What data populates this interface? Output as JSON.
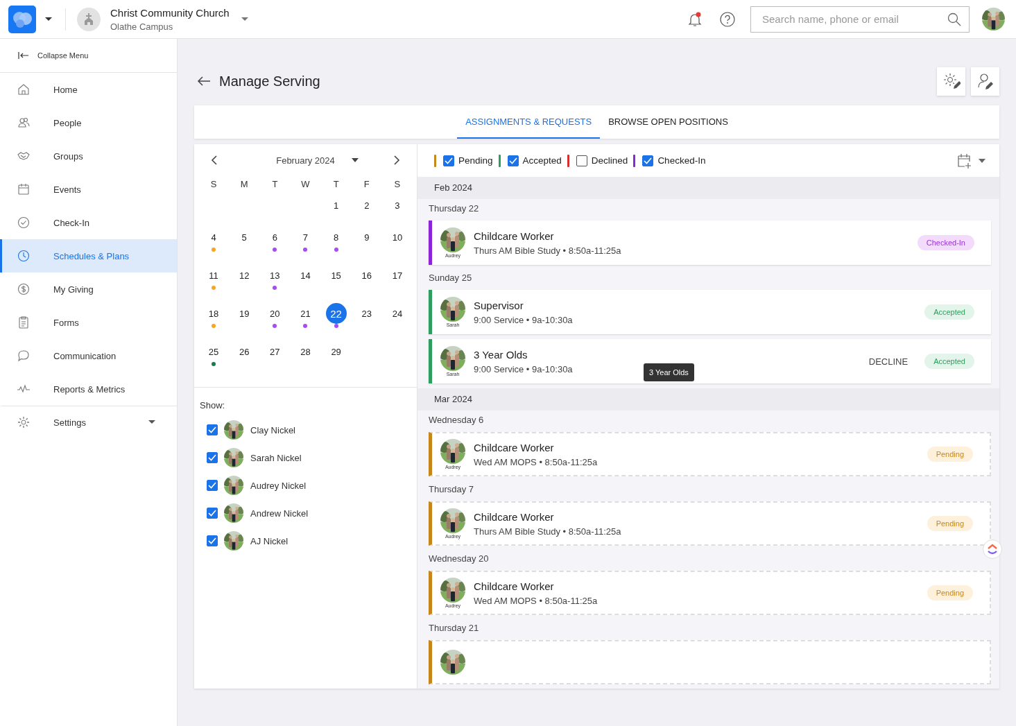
{
  "topbar": {
    "org_name": "Christ Community Church",
    "campus": "Olathe Campus",
    "notification_unread": true,
    "search": {
      "placeholder": "Search name, phone or email"
    }
  },
  "sidebar": {
    "collapse_label": "Collapse Menu",
    "items": [
      {
        "label": "Home",
        "selected": false
      },
      {
        "label": "People",
        "selected": false
      },
      {
        "label": "Groups",
        "selected": false
      },
      {
        "label": "Events",
        "selected": false
      },
      {
        "label": "Check-In",
        "selected": false
      },
      {
        "label": "Schedules & Plans",
        "selected": true
      },
      {
        "label": "My Giving",
        "selected": false
      },
      {
        "label": "Forms",
        "selected": false
      },
      {
        "label": "Communication",
        "selected": false
      },
      {
        "label": "Reports & Metrics",
        "selected": false
      }
    ],
    "settings_label": "Settings"
  },
  "page": {
    "title": "Manage Serving"
  },
  "tabs": [
    {
      "label": "ASSIGNMENTS & REQUESTS",
      "selected": true
    },
    {
      "label": "BROWSE OPEN POSITIONS",
      "selected": false
    }
  ],
  "calendar": {
    "month": "February 2024",
    "weekdays": [
      "S",
      "M",
      "T",
      "W",
      "T",
      "F",
      "S"
    ],
    "weeks": [
      {
        "days": [
          {
            "kind": "blank"
          },
          {
            "kind": "blank"
          },
          {
            "kind": "blank"
          },
          {
            "kind": "blank"
          },
          {
            "kind": "day",
            "day": "1",
            "selected": false
          },
          {
            "kind": "day",
            "day": "2",
            "selected": false
          },
          {
            "kind": "day",
            "day": "3",
            "selected": false
          }
        ]
      },
      {
        "days": [
          {
            "kind": "day",
            "day": "4",
            "selected": false,
            "color": "#f5a623"
          },
          {
            "kind": "day",
            "day": "5",
            "selected": false
          },
          {
            "kind": "day",
            "day": "6",
            "selected": false,
            "color": "#a64cf0"
          },
          {
            "kind": "day",
            "day": "7",
            "selected": false,
            "color": "#a64cf0"
          },
          {
            "kind": "day",
            "day": "8",
            "selected": false,
            "color": "#a64cf0"
          },
          {
            "kind": "day",
            "day": "9",
            "selected": false
          },
          {
            "kind": "day",
            "day": "10",
            "selected": false
          }
        ]
      },
      {
        "days": [
          {
            "kind": "day",
            "day": "11",
            "selected": false,
            "color": "#f5a623"
          },
          {
            "kind": "day",
            "day": "12",
            "selected": false
          },
          {
            "kind": "day",
            "day": "13",
            "selected": false,
            "color": "#a64cf0"
          },
          {
            "kind": "day",
            "day": "14",
            "selected": false
          },
          {
            "kind": "day",
            "day": "15",
            "selected": false
          },
          {
            "kind": "day",
            "day": "16",
            "selected": false
          },
          {
            "kind": "day",
            "day": "17",
            "selected": false
          }
        ]
      },
      {
        "days": [
          {
            "kind": "day",
            "day": "18",
            "selected": false,
            "color": "#f5a623"
          },
          {
            "kind": "day",
            "day": "19",
            "selected": false
          },
          {
            "kind": "day",
            "day": "20",
            "selected": false,
            "color": "#a64cf0"
          },
          {
            "kind": "day",
            "day": "21",
            "selected": false,
            "color": "#a64cf0"
          },
          {
            "kind": "day",
            "day": "22",
            "selected": true,
            "color": "#a64cf0"
          },
          {
            "kind": "day",
            "day": "23",
            "selected": false
          },
          {
            "kind": "day",
            "day": "24",
            "selected": false
          }
        ]
      },
      {
        "days": [
          {
            "kind": "day",
            "day": "25",
            "selected": false,
            "color": "#1e7a4a"
          },
          {
            "kind": "day",
            "day": "26",
            "selected": false
          },
          {
            "kind": "day",
            "day": "27",
            "selected": false
          },
          {
            "kind": "day",
            "day": "28",
            "selected": false
          },
          {
            "kind": "day",
            "day": "29",
            "selected": false
          }
        ]
      }
    ]
  },
  "show": {
    "label": "Show:",
    "people": [
      {
        "name": "Clay Nickel",
        "checked": true
      },
      {
        "name": "Sarah Nickel",
        "checked": true
      },
      {
        "name": "Audrey Nickel",
        "checked": true
      },
      {
        "name": "Andrew Nickel",
        "checked": true
      },
      {
        "name": "AJ Nickel",
        "checked": true
      }
    ]
  },
  "legend": [
    {
      "label": "Pending",
      "color": "#c8861a",
      "checked": true
    },
    {
      "label": "Accepted",
      "color": "#2e9e5e",
      "checked": true
    },
    {
      "label": "Declined",
      "color": "#d32f2f",
      "checked": false
    },
    {
      "label": "Checked-In",
      "color": "#8e24d8",
      "checked": true
    }
  ],
  "months": [
    {
      "label": "Feb 2024",
      "days": [
        {
          "label": "Thursday 22",
          "cards": [
            {
              "kind": "checkedin",
              "title": "Childcare Worker",
              "subtitle": "Thurs AM Bible Study • 8:50a-11:25a",
              "person": "Audrey",
              "badge": "Checked-In"
            }
          ]
        },
        {
          "label": "Sunday 25",
          "cards": [
            {
              "kind": "accepted",
              "title": "Supervisor",
              "subtitle": "9:00 Service • 9a-10:30a",
              "person": "Sarah",
              "badge": "Accepted"
            },
            {
              "kind": "accepted",
              "title": "3 Year Olds",
              "subtitle": "9:00 Service • 9a-10:30a",
              "person": "Sarah",
              "badge": "Accepted",
              "action": "DECLINE",
              "tooltip": "3 Year Olds"
            }
          ]
        }
      ]
    },
    {
      "label": "Mar 2024",
      "days": [
        {
          "label": "Wednesday 6",
          "cards": [
            {
              "kind": "pending",
              "title": "Childcare Worker",
              "subtitle": "Wed AM MOPS • 8:50a-11:25a",
              "person": "Audrey",
              "badge": "Pending"
            }
          ]
        },
        {
          "label": "Thursday 7",
          "cards": [
            {
              "kind": "pending",
              "title": "Childcare Worker",
              "subtitle": "Thurs AM Bible Study • 8:50a-11:25a",
              "person": "Audrey",
              "badge": "Pending"
            }
          ]
        },
        {
          "label": "Wednesday 20",
          "cards": [
            {
              "kind": "pending",
              "title": "Childcare Worker",
              "subtitle": "Wed AM MOPS • 8:50a-11:25a",
              "person": "Audrey",
              "badge": "Pending"
            }
          ]
        },
        {
          "label": "Thursday 21",
          "cards": [
            {
              "kind": "pending"
            }
          ]
        }
      ]
    }
  ]
}
